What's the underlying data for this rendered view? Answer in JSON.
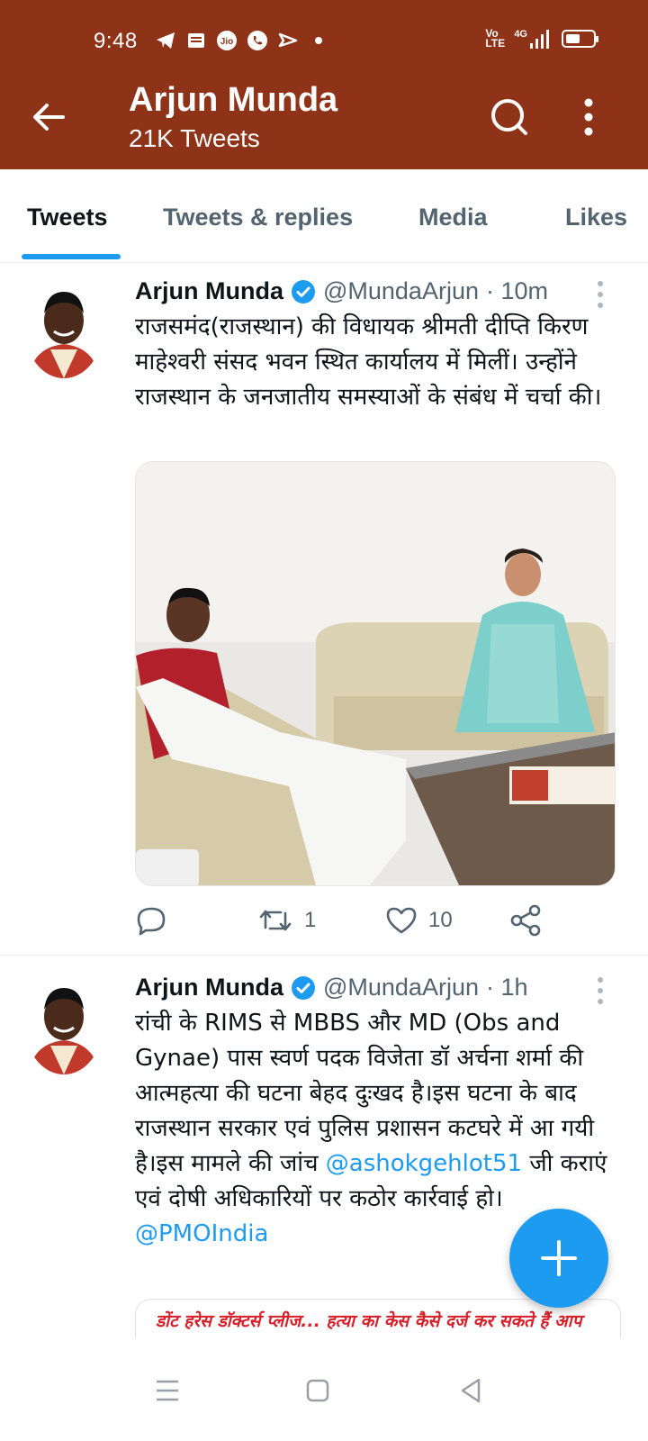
{
  "status_bar": {
    "time": "9:48",
    "network_label": "Vo LTE",
    "signal_label": "4G",
    "battery_level": 0.55
  },
  "header": {
    "title": "Arjun Munda",
    "subtitle": "21K Tweets",
    "background_color": "#8e3318"
  },
  "tabs": [
    {
      "label": "Tweets",
      "active": true
    },
    {
      "label": "Tweets & replies",
      "active": false
    },
    {
      "label": "Media",
      "active": false
    },
    {
      "label": "Likes",
      "active": false
    }
  ],
  "tweets": [
    {
      "name": "Arjun Munda",
      "handle": "@MundaArjun",
      "time": "· 10m",
      "text": "राजसमंद(राजस्थान) की विधायक श्रीमती दीप्ति किरण माहेश्वरी संसद भवन स्थित कार्यालय में मिलीं। उन्होंने राजस्थान के जनजातीय समस्याओं के संबंध में चर्चा की।",
      "retweets": "1",
      "likes": "10"
    },
    {
      "name": "Arjun Munda",
      "handle": "@MundaArjun",
      "time": "· 1h",
      "text_part1": "रांची के RIMS से MBBS और MD (Obs and Gynae) पास स्वर्ण पदक विजेता डॉ अर्चना शर्मा की आत्महत्या की घटना बेहद दुःखद है।इस घटना के बाद राजस्थान सरकार एवं पुलिस प्रशासन कटघरे में आ गयी है।इस मामले की जांच",
      "mention1": "@ashokgehlot51",
      "text_part2": "जी कराएं एवं दोषी अधिकारियों पर कठोर कार्रवाई हो।",
      "mention2": "@PMOIndia",
      "card_headline": "डोंट हरेस डॉक्टर्स प्लीज... हत्या का केस कैसे दर्ज कर सकते हैं आप"
    }
  ],
  "colors": {
    "accent": "#1d9bf0",
    "verified": "#1d9bf0"
  },
  "icons": [
    "back-arrow-icon",
    "search-icon",
    "more-vertical-icon",
    "verified-badge-icon",
    "reply-icon",
    "retweet-icon",
    "like-icon",
    "share-icon",
    "compose-plus-icon",
    "nav-menu-icon",
    "nav-home-icon",
    "nav-back-icon"
  ]
}
